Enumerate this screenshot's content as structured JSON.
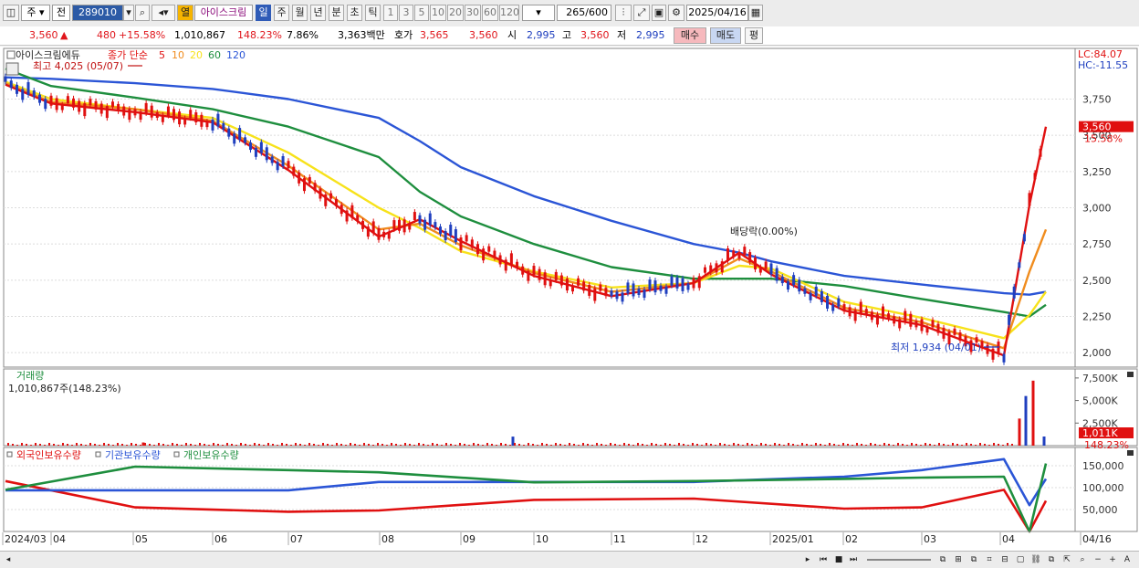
{
  "toolbar": {
    "market": "주",
    "prev_label": "전",
    "code": "289010",
    "stock_name": "아이스크림",
    "tag_label": "열",
    "periods": [
      "일",
      "주",
      "월",
      "년",
      "분",
      "초",
      "틱"
    ],
    "active_period": "일",
    "intervals": [
      "1",
      "3",
      "5",
      "10",
      "20",
      "30",
      "60",
      "120"
    ],
    "count": "265",
    "count_total": "/600",
    "date": "2025/04/16"
  },
  "quote": {
    "price": "3,560",
    "arrow": "▲",
    "change": "480",
    "change_pct": "+15.58%",
    "volume": "1,010,867",
    "volume_ratio": "148.23%",
    "turnover": "7.86%",
    "amount": "3,363백만",
    "bid_label": "호가",
    "bid_value": "3,565",
    "ask_value": "3,560",
    "open_label": "시",
    "open_value": "2,995",
    "high_label": "고",
    "high_value": "3,560",
    "low_label": "저",
    "low_value": "2,995",
    "buy_btn": "매수",
    "sell_btn": "매도",
    "eval_btn": "평"
  },
  "price_panel": {
    "title": "아이스크림에듀",
    "ma_label": "종가 단순",
    "ma_periods": [
      "5",
      "10",
      "20",
      "60",
      "120"
    ],
    "ma_colors": [
      "#e01010",
      "#f08c1e",
      "#f7e21b",
      "#1e8e3e",
      "#2b55d6"
    ],
    "high_marker": "최고 4,025 (05/07)",
    "low_marker": "최저 1,934 (04/01)",
    "exdiv_marker": "배당락(0.00%)",
    "lc": "LC:84.07",
    "hc": "HC:-11.55",
    "current_price": "3,560",
    "current_change": "15.58%",
    "y_ticks": [
      "3,750",
      "3,500",
      "3,250",
      "3,000",
      "2,750",
      "2,500",
      "2,250",
      "2,000"
    ]
  },
  "volume_panel": {
    "title": "거래량",
    "value": "1,010,867주(148.23%)",
    "current": "1,011K",
    "current_pct": "148.23%",
    "y_ticks": [
      "7,500K",
      "5,000K",
      "2,500K"
    ]
  },
  "holding_panel": {
    "series_names": [
      "외국인보유수량",
      "기관보유수량",
      "개인보유수량"
    ],
    "series_colors": [
      "#e01010",
      "#2b55d6",
      "#1e8e3e"
    ],
    "y_ticks": [
      "150,000",
      "100,000",
      "50,000"
    ]
  },
  "x_axis": {
    "labels": [
      "2024/03",
      "04",
      "05",
      "06",
      "07",
      "08",
      "09",
      "10",
      "11",
      "12",
      "2025/01",
      "02",
      "03",
      "04",
      "04/16"
    ]
  },
  "chart_data": {
    "type": "line",
    "title": "아이스크림에듀",
    "x_range": [
      "2024/03",
      "2025/04/16"
    ],
    "ylim": [
      1900,
      4100
    ],
    "x": [
      "2024-03",
      "2024-04",
      "2024-05",
      "2024-06",
      "2024-07",
      "2024-08",
      "2024-08b",
      "2024-09",
      "2024-10",
      "2024-11",
      "2024-12",
      "2024-12b",
      "2025-01",
      "2025-02",
      "2025-03",
      "2025-04-01",
      "2025-04-10",
      "2025-04-16"
    ],
    "series": [
      {
        "name": "5",
        "values": [
          3850,
          3720,
          3660,
          3590,
          3260,
          2800,
          2920,
          2770,
          2530,
          2390,
          2480,
          2690,
          2540,
          2290,
          2190,
          1980,
          3020,
          3560
        ]
      },
      {
        "name": "10",
        "values": [
          3860,
          3730,
          3680,
          3600,
          3290,
          2850,
          2890,
          2740,
          2550,
          2420,
          2480,
          2650,
          2560,
          2310,
          2210,
          2030,
          2560,
          2850
        ]
      },
      {
        "name": "20",
        "values": [
          3870,
          3750,
          3680,
          3620,
          3380,
          3000,
          2860,
          2700,
          2560,
          2450,
          2480,
          2600,
          2580,
          2350,
          2240,
          2100,
          2260,
          2420
        ]
      },
      {
        "name": "60",
        "values": [
          3960,
          3840,
          3760,
          3680,
          3560,
          3350,
          3110,
          2940,
          2750,
          2590,
          2510,
          2510,
          2510,
          2460,
          2370,
          2280,
          2250,
          2330
        ]
      },
      {
        "name": "120",
        "values": [
          3900,
          3890,
          3860,
          3820,
          3750,
          3620,
          3460,
          3280,
          3080,
          2910,
          2750,
          2690,
          2630,
          2530,
          2470,
          2410,
          2400,
          2420
        ]
      }
    ],
    "volume": {
      "x": [
        "2024-05-07",
        "2024-09-20",
        "2025-04-10",
        "2025-04-11",
        "2025-04-14",
        "2025-04-16"
      ],
      "values": [
        350,
        1000,
        3000,
        5500,
        7200,
        1011
      ],
      "unit": "K"
    },
    "holdings": {
      "x": [
        "2024-03",
        "2024-05",
        "2024-07",
        "2024-08",
        "2024-10",
        "2024-12",
        "2025-02",
        "2025-03",
        "2025-04-01",
        "2025-04-10",
        "2025-04-16"
      ],
      "series": [
        {
          "name": "외국인보유수량",
          "values": [
            115000,
            55000,
            45000,
            48000,
            72000,
            75000,
            52000,
            55000,
            95000,
            0,
            70000
          ]
        },
        {
          "name": "기관보유수량",
          "values": [
            94000,
            94000,
            94000,
            113000,
            113000,
            113000,
            125000,
            140000,
            165000,
            60000,
            120000
          ]
        },
        {
          "name": "개인보유수량",
          "values": [
            95000,
            148000,
            140000,
            135000,
            112000,
            115000,
            120000,
            123000,
            125000,
            0,
            155000
          ]
        }
      ]
    }
  }
}
